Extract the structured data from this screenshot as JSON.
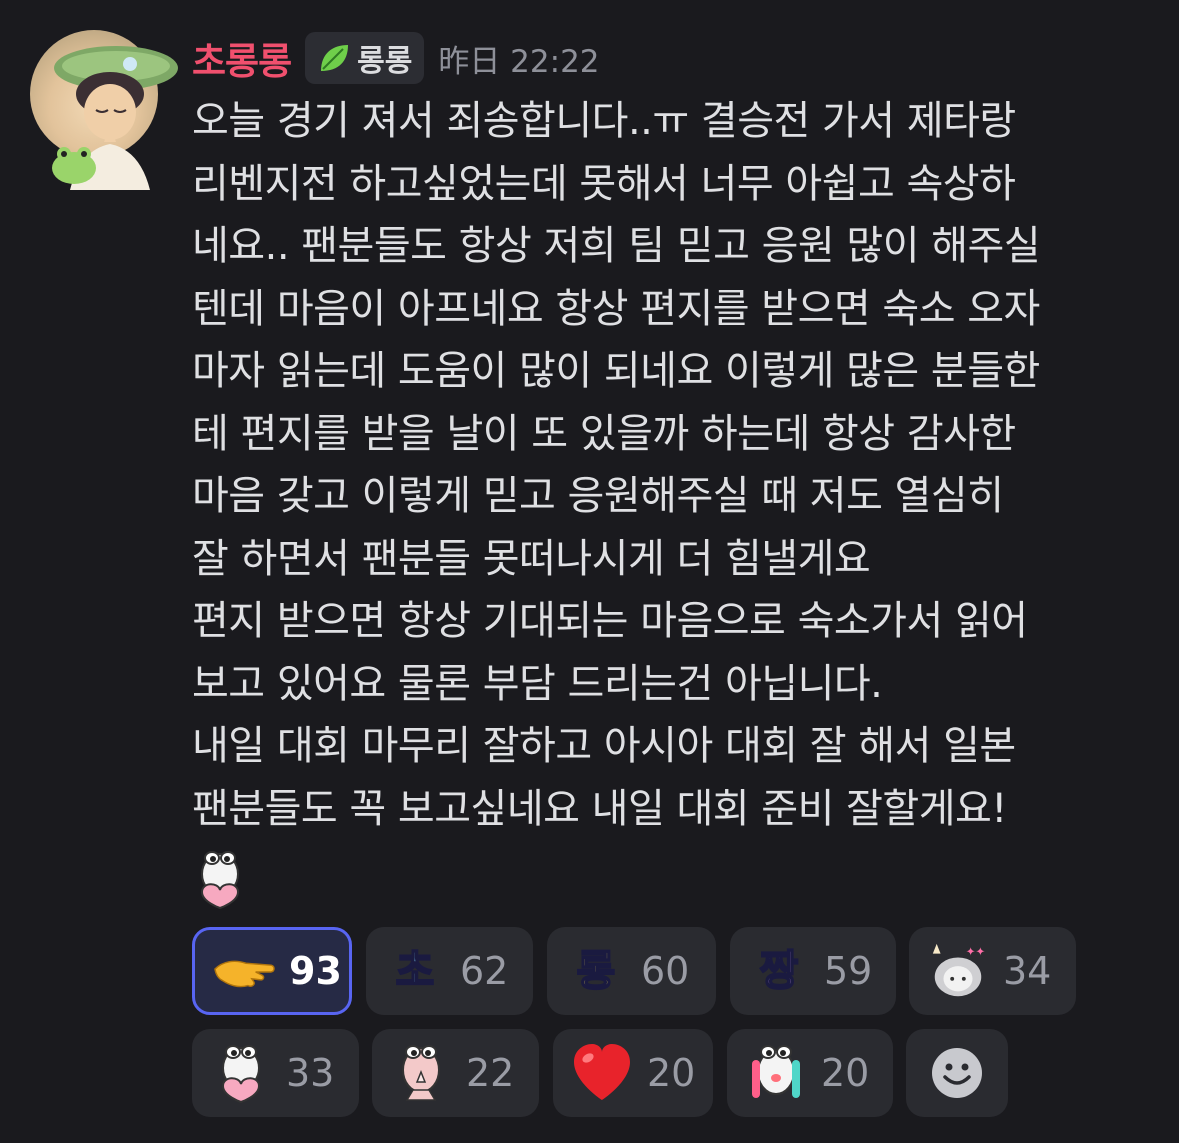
{
  "message": {
    "username": "초롱롱",
    "role_tag": {
      "label": "롱롱",
      "icon": "leaf-icon"
    },
    "timestamp": "昨日 22:22",
    "lines": [
      "오늘 경기 져서 죄송합니다..ㅠ 결승전 가서 제타랑",
      "리벤지전 하고싶었는데 못해서 너무 아쉽고 속상하",
      "네요.. 팬분들도 항상 저희 팀 믿고 응원 많이 해주실",
      "텐데 마음이 아프네요 항상 편지를 받으면 숙소 오자",
      "마자 읽는데 도움이 많이 되네요 이렇게 많은 분들한",
      "테 편지를 받을 날이 또 있을까 하는데 항상 감사한",
      "마음 갖고 이렇게 믿고 응원해주실 때 저도 열심히",
      "잘 하면서 팬분들 못떠나시게 더 힘낼게요",
      "편지 받으면 항상 기대되는 마음으로 숙소가서 읽어",
      "보고 있어요 물론 부담 드리는건 아닙니다.",
      "내일 대회 마무리 잘하고 아시아 대회 잘 해서 일본",
      "팬분들도 꼭 보고싶네요 내일 대회 준비 잘할게요!"
    ],
    "sticker": "heart-hug-sticker"
  },
  "reactions": [
    {
      "icon": "pointing-hand-emoji",
      "count": "93",
      "active": true
    },
    {
      "icon": "cho-text-emoji",
      "glyph": "초",
      "color": "#7fd4f5",
      "count": "62"
    },
    {
      "icon": "rong-text-emoji",
      "glyph": "롱",
      "color": "#f5e35a",
      "count": "60"
    },
    {
      "icon": "jjang-text-emoji",
      "glyph": "짱",
      "color": "#c89bf0",
      "count": "59"
    },
    {
      "icon": "sparkle-character-emoji",
      "count": "34"
    },
    {
      "icon": "heart-hug-emoji",
      "count": "33"
    },
    {
      "icon": "praying-character-emoji",
      "count": "22"
    },
    {
      "icon": "red-heart-emoji",
      "count": "20"
    },
    {
      "icon": "crying-character-emoji",
      "count": "20"
    },
    {
      "icon": "add-reaction-icon"
    }
  ]
}
